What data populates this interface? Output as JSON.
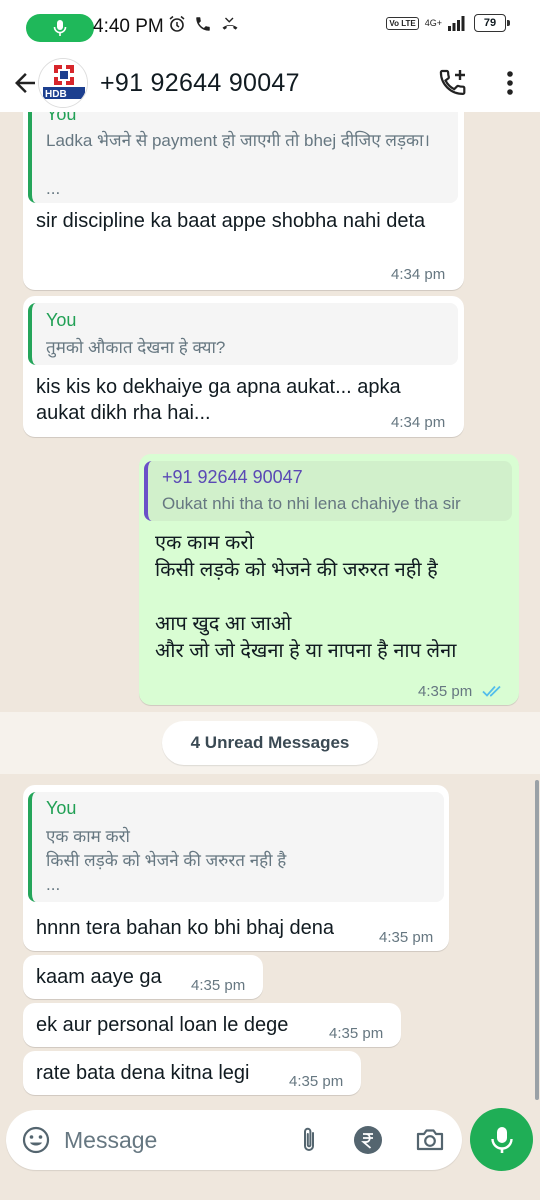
{
  "status_bar": {
    "time": "4:40 PM",
    "volte": "Vo LTE",
    "network": "4G+",
    "battery": "79"
  },
  "header": {
    "contact_name": "+91 92644 90047",
    "avatar_text": "HDB"
  },
  "messages": [
    {
      "direction": "in",
      "quote_author": "You",
      "quote_text": "Ladka भेजने से payment हो जाएगी तो bhej दीजिए लड़का।",
      "quote_more": "...",
      "text": "sir discipline ka baat appe shobha nahi deta",
      "time": "4:34 pm"
    },
    {
      "direction": "in",
      "quote_author": "You",
      "quote_text": "तुमको औकात देखना हे क्या?",
      "text": "kis kis ko dekhaiye ga apna aukat... apka aukat dikh rha hai...",
      "time": "4:34 pm"
    },
    {
      "direction": "out",
      "quote_author": "+91 92644 90047",
      "quote_text": "Oukat nhi tha to nhi lena chahiye tha sir",
      "text_lines": [
        "एक काम करो",
        "किसी लड़के को भेजने की जरुरत नही है",
        "",
        "आप खुद आ जाओ",
        "और जो जो देखना हे या नापना है नाप लेना"
      ],
      "time": "4:35 pm",
      "status": "read"
    },
    {
      "direction": "in",
      "quote_author": "You",
      "quote_lines": [
        "एक काम करो",
        "किसी लड़के को भेजने की जरुरत नही है"
      ],
      "quote_more": "...",
      "text": "hnnn tera bahan ko bhi bhaj dena",
      "time": "4:35 pm"
    },
    {
      "direction": "in",
      "text": "kaam aaye ga",
      "time": "4:35 pm"
    },
    {
      "direction": "in",
      "text": "ek aur personal loan le dege",
      "time": "4:35 pm"
    },
    {
      "direction": "in",
      "text": "rate bata dena kitna legi",
      "time": "4:35 pm"
    }
  ],
  "unread_label": "4 Unread Messages",
  "input": {
    "placeholder": "Message"
  },
  "icons": {
    "back": "arrow-left-icon",
    "call_add": "phone-plus-icon",
    "menu": "more-vertical-icon",
    "emoji": "emoji-icon",
    "attach": "paperclip-icon",
    "payment": "rupee-icon",
    "camera": "camera-icon",
    "mic": "mic-icon",
    "read_ticks": "double-check-icon"
  },
  "colors": {
    "accent_green": "#1fae56",
    "outgoing_bubble": "#d9fdd3",
    "incoming_bubble": "#ffffff",
    "read_tick_blue": "#53bdeb"
  }
}
